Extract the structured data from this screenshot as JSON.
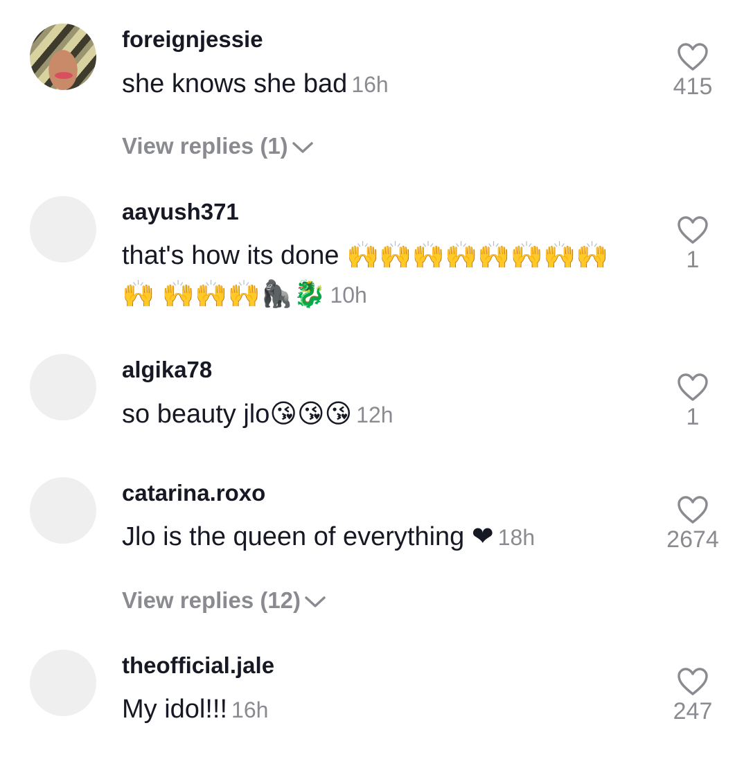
{
  "comments": [
    {
      "username": "foreignjessie",
      "text": "she knows she bad",
      "time": "16h",
      "likes": "415",
      "replies_label": "View replies (1)",
      "avatar": "photo"
    },
    {
      "username": "aayush371",
      "text": "that's how its done 🙌🙌🙌🙌🙌🙌🙌🙌🙌 🙌🙌🙌🦍🐉",
      "time": "10h",
      "likes": "1",
      "avatar": "placeholder"
    },
    {
      "username": "algika78",
      "text": "so beauty jlo😘😘😘",
      "time": "12h",
      "likes": "1",
      "avatar": "placeholder"
    },
    {
      "username": "catarina.roxo",
      "text": "Jlo is the queen of everything ❤",
      "time": "18h",
      "likes": "2674",
      "replies_label": "View replies (12)",
      "avatar": "placeholder"
    },
    {
      "username": "theofficial.jale",
      "text": "My idol!!!",
      "time": "16h",
      "likes": "247",
      "avatar": "placeholder"
    }
  ],
  "icons": {
    "like": "heart-outline-icon",
    "chevron": "chevron-down-icon"
  },
  "colors": {
    "primary_text": "#161823",
    "secondary_text": "#8a8b91",
    "avatar_placeholder": "#efefef"
  }
}
